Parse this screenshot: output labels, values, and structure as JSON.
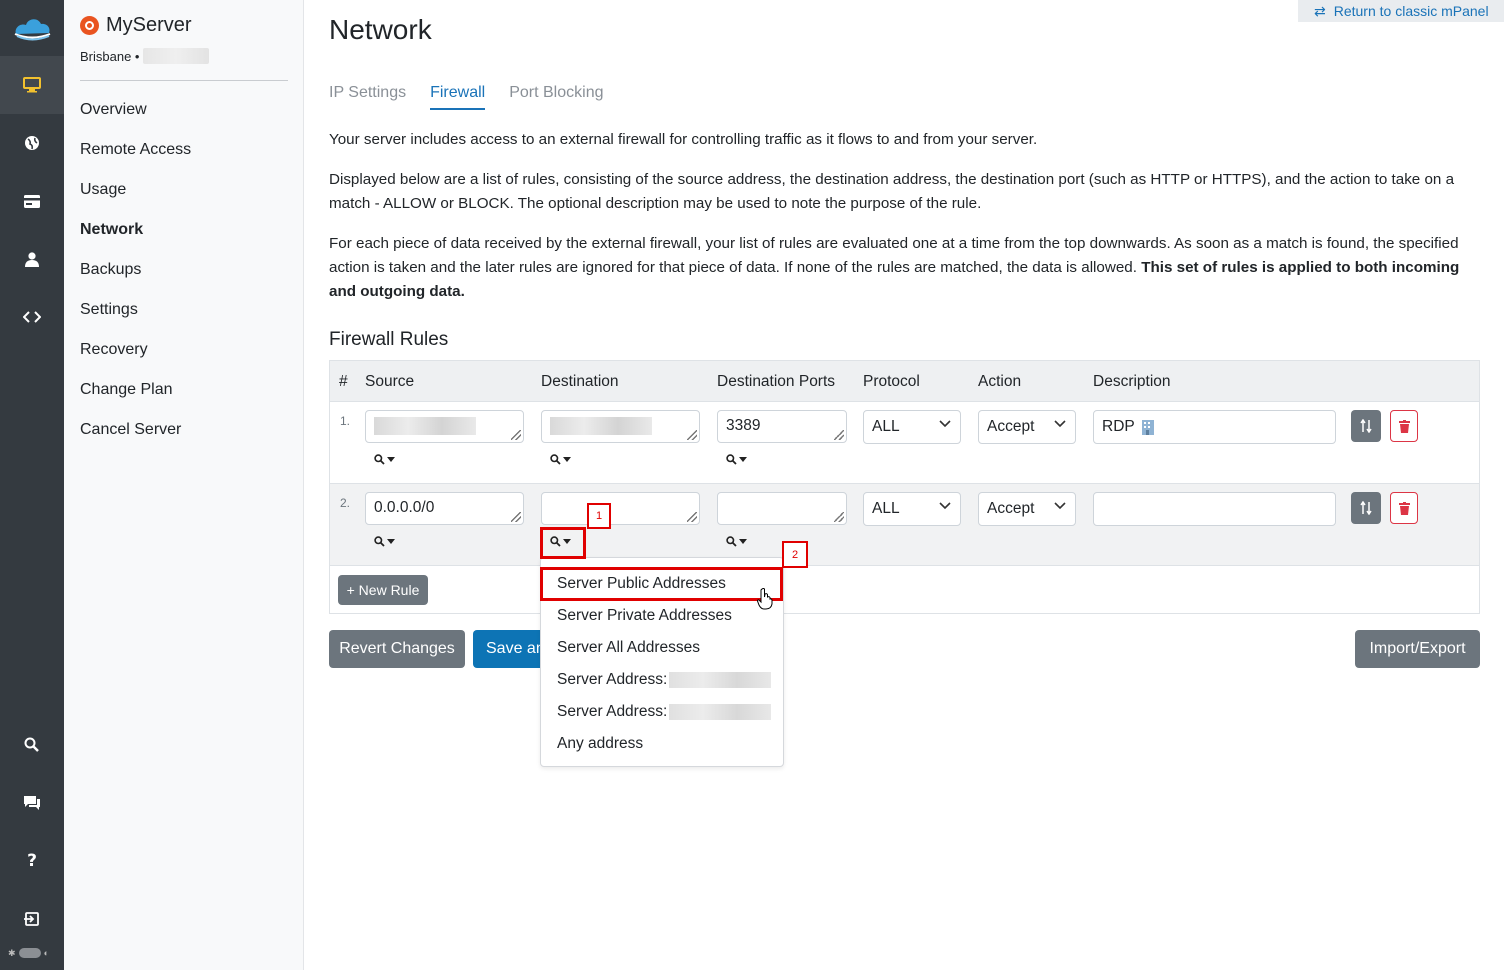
{
  "window": {
    "server_name": "MyServer",
    "location": "Brisbane •",
    "classic_link": "Return to classic mPanel"
  },
  "rail": {
    "icons": [
      "cloud-logo-icon",
      "monitor-icon",
      "globe-icon",
      "card-icon",
      "user-icon",
      "code-icon",
      "search-icon",
      "chat-icon",
      "help-icon",
      "logout-icon",
      "theme-toggle-icon"
    ]
  },
  "sidebar": {
    "items": [
      {
        "label": "Overview"
      },
      {
        "label": "Remote Access"
      },
      {
        "label": "Usage"
      },
      {
        "label": "Network",
        "active": true
      },
      {
        "label": "Backups"
      },
      {
        "label": "Settings"
      },
      {
        "label": "Recovery"
      },
      {
        "label": "Change Plan"
      },
      {
        "label": "Cancel Server"
      }
    ]
  },
  "main": {
    "title": "Network",
    "tabs": [
      {
        "label": "IP Settings"
      },
      {
        "label": "Firewall",
        "active": true
      },
      {
        "label": "Port Blocking"
      }
    ],
    "para1": "Your server includes access to an external firewall for controlling traffic as it flows to and from your server.",
    "para2": "Displayed below are a list of rules, consisting of the source address, the destination address, the destination port (such as HTTP or HTTPS), and the action to take on a match - ALLOW or BLOCK. The optional description may be used to note the purpose of the rule.",
    "para3_plain": "For each piece of data received by the external firewall, your list of rules are evaluated one at a time from the top downwards. As soon as a match is found, the specified action is taken and the later rules are ignored for that piece of data. If none of the rules are matched, the data is allowed. ",
    "para3_bold": "This set of rules is applied to both incoming and outgoing data.",
    "section_title": "Firewall Rules"
  },
  "table": {
    "headers": [
      "#",
      "Source",
      "Destination",
      "Destination Ports",
      "Protocol",
      "Action",
      "Description"
    ],
    "rows": [
      {
        "num": "1.",
        "source": "",
        "destination": "",
        "ports": "3389",
        "protocol": "ALL",
        "action": "Accept",
        "description": "RDP"
      },
      {
        "num": "2.",
        "source": "0.0.0.0/0",
        "destination": "",
        "ports": "",
        "protocol": "ALL",
        "action": "Accept",
        "description": ""
      }
    ],
    "new_rule": "+ New Rule"
  },
  "buttons": {
    "revert": "Revert Changes",
    "save": "Save an",
    "import_export": "Import/Export"
  },
  "dropdown": {
    "items": [
      "Server Public Addresses",
      "Server Private Addresses",
      "Server All Addresses",
      "Server Address:",
      "Server Address:",
      "Any address"
    ]
  },
  "annotations": {
    "step1": "1",
    "step2": "2",
    "color": "#e00000"
  }
}
